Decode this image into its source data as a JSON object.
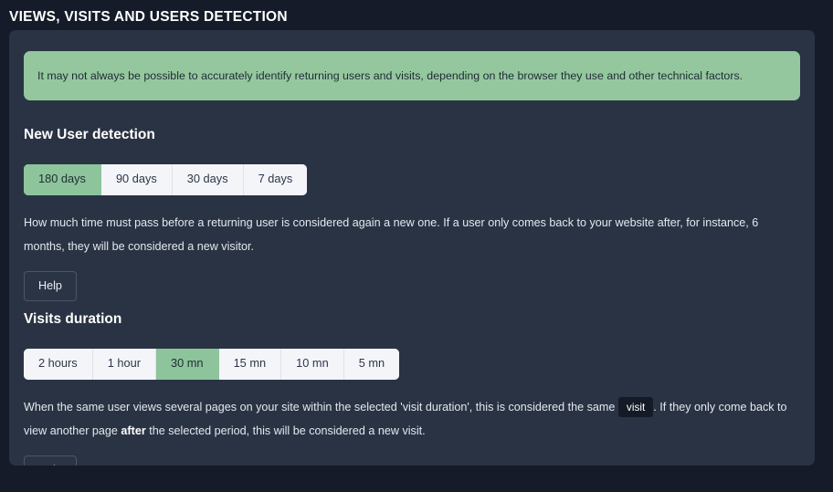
{
  "header": {
    "title": "VIEWS, VISITS AND USERS DETECTION"
  },
  "alert": {
    "text": "It may not always be possible to accurately identify returning users and visits, depending on the browser they use and other technical factors.",
    "background_color": "#95c79f",
    "text_color": "#1d2b33"
  },
  "colors": {
    "page_background": "#151b28",
    "card_background": "#2a3343",
    "accent_green": "#8dc49b",
    "segment_background": "#f4f5f9",
    "text_primary": "#ffffff",
    "text_body": "#e3e8f0"
  },
  "sections": [
    {
      "id": "new-user-detection",
      "title": "New User detection",
      "options": [
        {
          "label": "180 days",
          "selected": true
        },
        {
          "label": "90 days",
          "selected": false
        },
        {
          "label": "30 days",
          "selected": false
        },
        {
          "label": "7 days",
          "selected": false
        }
      ],
      "description_part1": "How much time must pass before a returning user is considered again a new one. If a user only comes back to your website after, for instance, 6 months, they will be considered a new visitor.",
      "help_label": "Help"
    },
    {
      "id": "visits-duration",
      "title": "Visits duration",
      "options": [
        {
          "label": "2 hours",
          "selected": false
        },
        {
          "label": "1 hour",
          "selected": false
        },
        {
          "label": "30 mn",
          "selected": true
        },
        {
          "label": "15 mn",
          "selected": false
        },
        {
          "label": "10 mn",
          "selected": false
        },
        {
          "label": "5 mn",
          "selected": false
        }
      ],
      "description_part1": "When the same user views several pages on your site within the selected 'visit duration', this is considered the same ",
      "description_code": "visit",
      "description_part2": ". If they only come back to view another page ",
      "description_bold": "after",
      "description_part3": " the selected period, this will be considered a new visit.",
      "help_label": "Help"
    }
  ]
}
